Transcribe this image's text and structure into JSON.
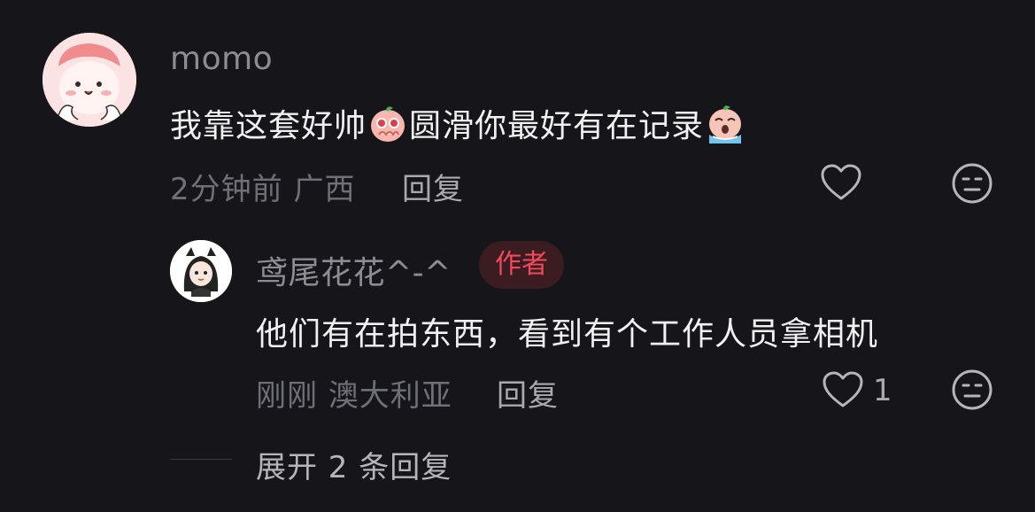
{
  "comment": {
    "username": "momo",
    "text_part1": "我靠这套好帅",
    "text_part2": "圆滑你最好有在记录",
    "emoji1": "pleading-face-emoji",
    "emoji2": "crying-face-emoji",
    "time": "2分钟前",
    "location": "广西",
    "reply_label": "回复"
  },
  "reply": {
    "username": "鸢尾花花^-^",
    "badge": "作者",
    "text": "他们有在拍东西，看到有个工作人员拿相机",
    "time": "刚刚",
    "location": "澳大利亚",
    "reply_label": "回复",
    "like_count": "1"
  },
  "expand_label": "展开 2 条回复",
  "icons": {
    "like": "heart-outline-icon",
    "dislike": "neutral-face-icon"
  },
  "colors": {
    "background": "#16161a",
    "author_badge_text": "#f24a5a",
    "author_badge_bg": "#3a1c21"
  }
}
